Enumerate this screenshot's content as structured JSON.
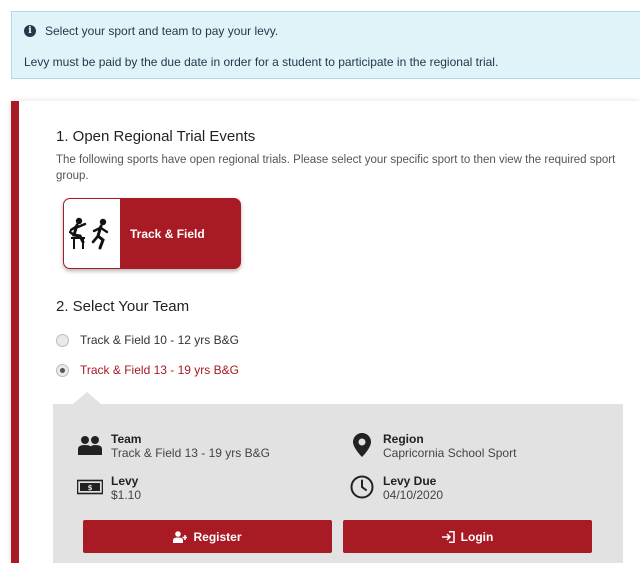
{
  "alert": {
    "line1": "Select your sport and team to pay your levy.",
    "line2": "Levy must be paid by the due date in order for a student to participate in the regional trial."
  },
  "step1": {
    "title": "1. Open Regional Trial Events",
    "description": "The following sports have open regional trials. Please select your specific sport to then view the required sport group.",
    "sports": [
      {
        "label": "Track & Field",
        "icon": "athletics-icon"
      }
    ]
  },
  "step2": {
    "title": "2. Select Your Team",
    "options": [
      {
        "label": "Track & Field 10 - 12 yrs B&G",
        "selected": false
      },
      {
        "label": "Track & Field 13 - 19 yrs B&G",
        "selected": true
      }
    ]
  },
  "details": {
    "team_label": "Team",
    "team_value": "Track & Field 13 - 19 yrs B&G",
    "region_label": "Region",
    "region_value": "Capricornia School Sport",
    "levy_label": "Levy",
    "levy_value": "$1.10",
    "due_label": "Levy Due",
    "due_value": "04/10/2020"
  },
  "buttons": {
    "register": "Register",
    "login": "Login"
  },
  "colors": {
    "accent": "#a81a24",
    "alert_bg": "#dff3f8",
    "panel_bg": "#e2e2e2"
  }
}
